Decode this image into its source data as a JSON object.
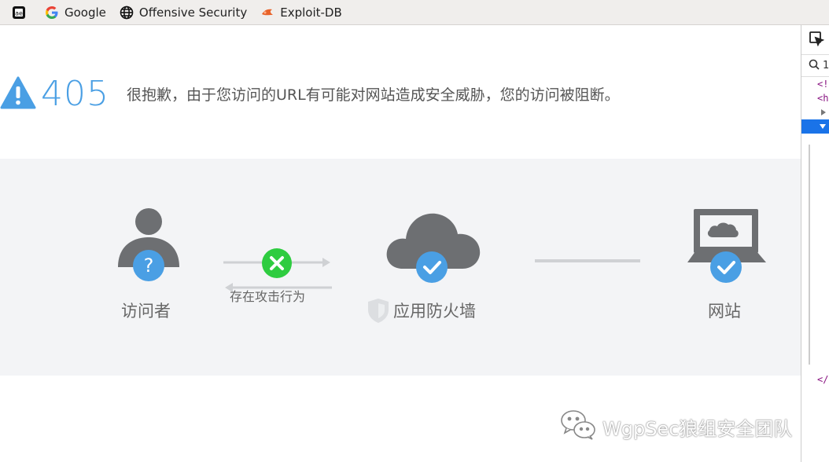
{
  "bookmarks": [
    {
      "label": "",
      "icon": "ae-app-icon"
    },
    {
      "label": "Google",
      "icon": "google-icon"
    },
    {
      "label": "Offensive Security",
      "icon": "globe-icon"
    },
    {
      "label": "Exploit-DB",
      "icon": "exploit-db-icon"
    }
  ],
  "error": {
    "code": "405",
    "message": "很抱歉，由于您访问的URL有可能对网站造成安全威胁，您的访问被阻断。"
  },
  "diagram": {
    "visitor_label": "访问者",
    "attack_label": "存在攻击行为",
    "waf_label": "应用防火墙",
    "site_label": "网站"
  },
  "watermark": {
    "text": "WgpSec狼组安全团队"
  },
  "devtools": {
    "search_text": "1",
    "lines": [
      "<!",
      "<h",
      "",
      "",
      "</"
    ]
  },
  "colors": {
    "accent": "#4a9fe4",
    "danger": "#2ecc40",
    "icon_gray": "#6d6f72"
  }
}
